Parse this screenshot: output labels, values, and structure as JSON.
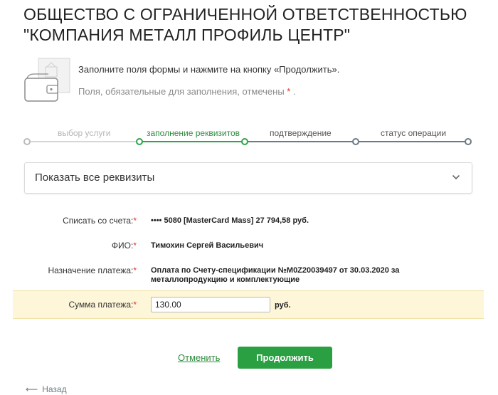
{
  "header": {
    "title_line1": "ОБЩЕСТВО С ОГРАНИЧЕННОЙ ОТВЕТСТВЕННОСТЬЮ",
    "title_line2": "\"КОМПАНИЯ МЕТАЛЛ ПРОФИЛЬ ЦЕНТР\""
  },
  "intro": {
    "instruction": "Заполните поля формы и нажмите на кнопку «Продолжить».",
    "required_note": "Поля, обязательные для заполнения, отмечены",
    "required_mark": "*",
    "required_tail": "."
  },
  "stepper": {
    "steps": [
      {
        "label": "выбор услуги",
        "state": "done"
      },
      {
        "label": "заполнение реквизитов",
        "state": "active"
      },
      {
        "label": "подтверждение",
        "state": "next"
      },
      {
        "label": "статус операции",
        "state": "next"
      }
    ]
  },
  "details_toggle": {
    "label": "Показать все реквизиты",
    "icon": "chevron-down-icon"
  },
  "form": {
    "required_mark": "*",
    "account_label": "Списать со счета:",
    "account_value": "•••• 5080  [MasterCard Mass] 27 794,58   руб.",
    "fio_label": "ФИО:",
    "fio_value": "Тимохин Сергей Васильевич",
    "purpose_label": "Назначение платежа:",
    "purpose_value_line1": "Оплата по Счету-спецификации №М0Z20039497 от 30.03.2020 за",
    "purpose_value_line2": "металлопродукцию и комплектующие",
    "amount_label": "Сумма платежа:",
    "amount_value": "130.00",
    "amount_currency": "руб."
  },
  "actions": {
    "cancel_label": "Отменить",
    "continue_label": "Продолжить",
    "back_label": "Назад"
  },
  "colors": {
    "accent_green": "#2aa043",
    "required_red": "#e0312b",
    "highlight_band": "#fdf6d8"
  }
}
